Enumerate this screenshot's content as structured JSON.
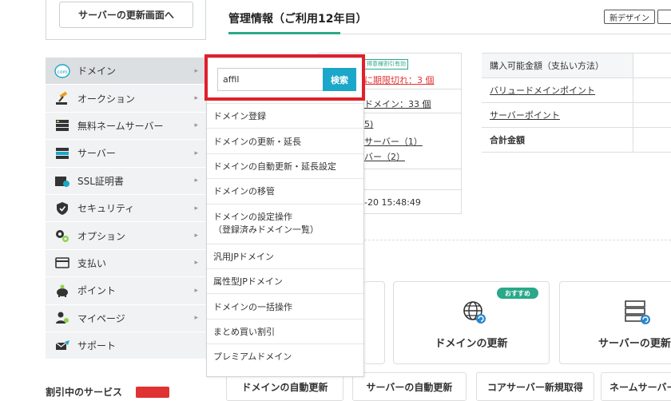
{
  "top": {
    "update_button": "サーバーの更新画面へ",
    "mgmt_title": "管理情報（ご利用12年目）",
    "new_design": "新デザイン"
  },
  "sidebar": {
    "items": [
      {
        "label": "ドメイン",
        "icon": "com-domain-icon"
      },
      {
        "label": "オークション",
        "icon": "auction-gavel-icon"
      },
      {
        "label": "無料ネームサーバー",
        "icon": "nameserver-icon"
      },
      {
        "label": "サーバー",
        "icon": "server-icon"
      },
      {
        "label": "SSL証明書",
        "icon": "ssl-certificate-icon"
      },
      {
        "label": "セキュリティ",
        "icon": "shield-icon"
      },
      {
        "label": "オプション",
        "icon": "gears-icon"
      },
      {
        "label": "支払い",
        "icon": "payment-card-icon"
      },
      {
        "label": "ポイント",
        "icon": "piggy-bank-icon"
      },
      {
        "label": "マイページ",
        "icon": "mypage-users-icon"
      },
      {
        "label": "サポート",
        "icon": "support-envelope-icon"
      }
    ]
  },
  "dropdown": {
    "search_value": "affil",
    "search_button": "検索",
    "items": [
      "ドメイン登録",
      "ドメインの更新・延長",
      "ドメインの自動更新・延長設定",
      "ドメインの移管",
      "ドメインの設定操作\n（登録済みドメイン一覧）",
      "汎用JPドメイン",
      "属性型JPドメイン",
      "ドメインの一括操作",
      "まとめ買い割引",
      "プレミアムドメイン"
    ]
  },
  "info": {
    "badge": "得意様割引有効",
    "expired_link": "に期限切れ：3 個",
    "domain_count": "ドメイン：33 個",
    "count_5": "5)",
    "server_1": "サーバー（1）",
    "bar_2": "バー（2）",
    "datetime": "-20 15:48:49"
  },
  "payment": {
    "rows": [
      {
        "label": "購入可能金額（支払い方法）",
        "style": "head"
      },
      {
        "label": "バリュードメインポイント",
        "style": "link"
      },
      {
        "label": "サーバーポイント",
        "style": "link"
      },
      {
        "label": "合計金額",
        "style": "bold"
      }
    ]
  },
  "cards": {
    "recommend": "おすすめ",
    "domain_renew": "ドメインの更新",
    "server_renew": "サーバーの更新"
  },
  "bottom": {
    "domain_auto": "ドメインの自動更新",
    "server_auto": "サーバーの自動更新",
    "core_server": "コアサーバー新規取得",
    "name_server": "ネームサーバー"
  },
  "discount": {
    "title": "割引中のサービス"
  },
  "colors": {
    "accent_green": "#2aa88a",
    "search_blue": "#1aa7c9",
    "highlight_red": "#e0202a",
    "alert_red": "#e03232"
  }
}
